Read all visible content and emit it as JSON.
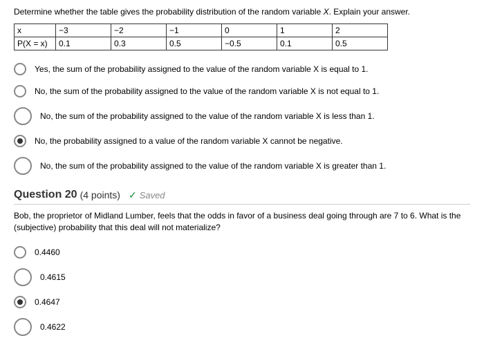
{
  "q19": {
    "prompt_pre": "Determine whether the table gives the probability distribution of the random variable ",
    "prompt_var": "X",
    "prompt_post": ". Explain your answer.",
    "table": {
      "r1": [
        "x",
        "−3",
        "−2",
        "−1",
        "0",
        "1",
        "2"
      ],
      "r2": [
        "P(X = x)",
        "0.1",
        "0.3",
        "0.5",
        "−0.5",
        "0.1",
        "0.5"
      ]
    },
    "opts": [
      "Yes, the sum of the probability assigned to the value of the random variable X is equal to 1.",
      "No, the sum of the probability assigned to the value of the random variable X is not equal to 1.",
      "No, the sum of the probability assigned to the value of the random variable X is less than 1.",
      "No, the probability assigned to a value of the random variable X cannot be negative.",
      "No, the sum of the probability assigned to the value of the random variable X is greater than 1."
    ],
    "selected": 3
  },
  "q20": {
    "title": "Question 20",
    "points": "(4 points)",
    "saved": "Saved",
    "body": "Bob, the proprietor of Midland Lumber, feels that the odds in favor of a business deal going through are 7 to 6. What is the (subjective) probability that this deal will not materialize?",
    "opts": [
      "0.4460",
      "0.4615",
      "0.4647",
      "0.4622"
    ],
    "selected": 2
  }
}
